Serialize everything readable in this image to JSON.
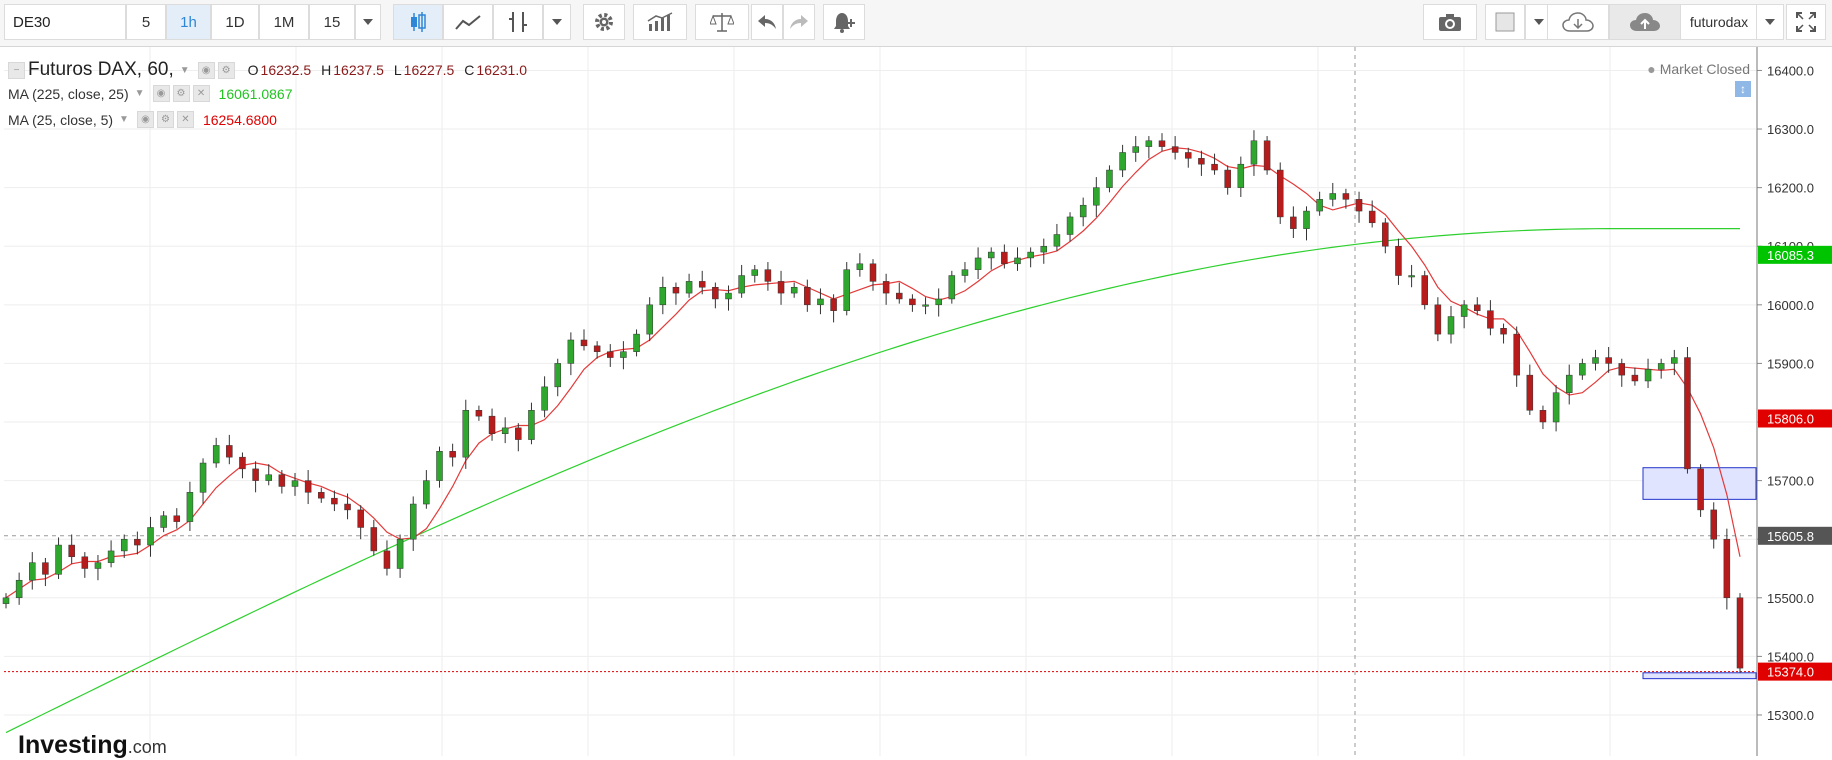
{
  "toolbar": {
    "symbol": "DE30",
    "intervals": [
      "5",
      "1h",
      "1D",
      "1M",
      "15"
    ],
    "active_interval": "1h",
    "user": "futurodax",
    "icons": [
      "dropdown-caret-icon",
      "candlestick-icon",
      "line-chart-icon",
      "indicators-icon",
      "dropdown-caret-icon",
      "settings-gear-icon",
      "studies-icon",
      "compare-scale-icon",
      "undo-icon",
      "redo-icon",
      "alert-bell-icon",
      "camera-icon",
      "color-square-icon",
      "cloud-download-icon",
      "cloud-upload-icon",
      "fullscreen-icon"
    ]
  },
  "legend": {
    "title": "Futuros DAX, 60,",
    "ohlc": [
      {
        "k": "O",
        "v": "16232.5"
      },
      {
        "k": "H",
        "v": "16237.5"
      },
      {
        "k": "L",
        "v": "16227.5"
      },
      {
        "k": "C",
        "v": "16231.0"
      }
    ],
    "ma1": {
      "label": "MA (225, close, 25)",
      "value": "16061.0867",
      "color": "#22c322"
    },
    "ma2": {
      "label": "MA (25, close, 5)",
      "value": "16254.6800",
      "color": "#e00000"
    }
  },
  "market_status": "Market Closed",
  "logo": {
    "brand": "Investing",
    "suffix": ".com"
  },
  "colors": {
    "up": "#2fa72f",
    "down": "#b71c1c",
    "ma_long": "#2ed02e",
    "ma_short": "#e33a3a",
    "grid": "#eeeeee",
    "zone": "#e0e4ff"
  },
  "chart_data": {
    "type": "candlestick",
    "y_ticks": [
      "16400.0",
      "16300.0",
      "16200.0",
      "16100.0",
      "16000.0",
      "15900.0",
      "15800.0",
      "15700.0",
      "15600.0",
      "15500.0",
      "15400.0",
      "15300.0"
    ],
    "ylim": [
      15230,
      16440
    ],
    "grid": true,
    "price_labels": [
      {
        "value": 16085.3,
        "text": "16085.3",
        "color": "#00c400"
      },
      {
        "value": 15806.0,
        "text": "15806.0",
        "color": "#e00000"
      },
      {
        "value": 15605.8,
        "text": "15605.8",
        "color": "#555555"
      },
      {
        "value": 15374.0,
        "text": "15374.0",
        "color": "#e00000"
      }
    ],
    "crosshair_y": 15605.8,
    "last_price_line": 15374.0,
    "zones": [
      [
        15722,
        15668
      ],
      [
        15372,
        15362
      ]
    ],
    "closes": [
      15500,
      15530,
      15560,
      15540,
      15590,
      15570,
      15550,
      15560,
      15580,
      15600,
      15590,
      15620,
      15640,
      15630,
      15680,
      15730,
      15760,
      15740,
      15720,
      15700,
      15710,
      15690,
      15700,
      15680,
      15670,
      15660,
      15650,
      15620,
      15580,
      15550,
      15600,
      15660,
      15700,
      15750,
      15740,
      15820,
      15810,
      15780,
      15790,
      15770,
      15820,
      15860,
      15900,
      15940,
      15930,
      15920,
      15910,
      15920,
      15950,
      16000,
      16030,
      16020,
      16040,
      16030,
      16010,
      16020,
      16050,
      16060,
      16040,
      16020,
      16030,
      16000,
      16010,
      15990,
      16060,
      16070,
      16040,
      16020,
      16010,
      16000,
      16000,
      16010,
      16050,
      16060,
      16080,
      16090,
      16070,
      16080,
      16090,
      16100,
      16120,
      16150,
      16170,
      16200,
      16230,
      16260,
      16270,
      16280,
      16270,
      16260,
      16250,
      16240,
      16230,
      16200,
      16240,
      16280,
      16230,
      16150,
      16130,
      16160,
      16180,
      16190,
      16180,
      16160,
      16140,
      16100,
      16050,
      16050,
      16000,
      15950,
      15980,
      16000,
      15990,
      15960,
      15950,
      15880,
      15820,
      15800,
      15850,
      15880,
      15900,
      15910,
      15900,
      15880,
      15870,
      15890,
      15900,
      15910,
      15720,
      15650,
      15600,
      15500,
      15380
    ]
  }
}
